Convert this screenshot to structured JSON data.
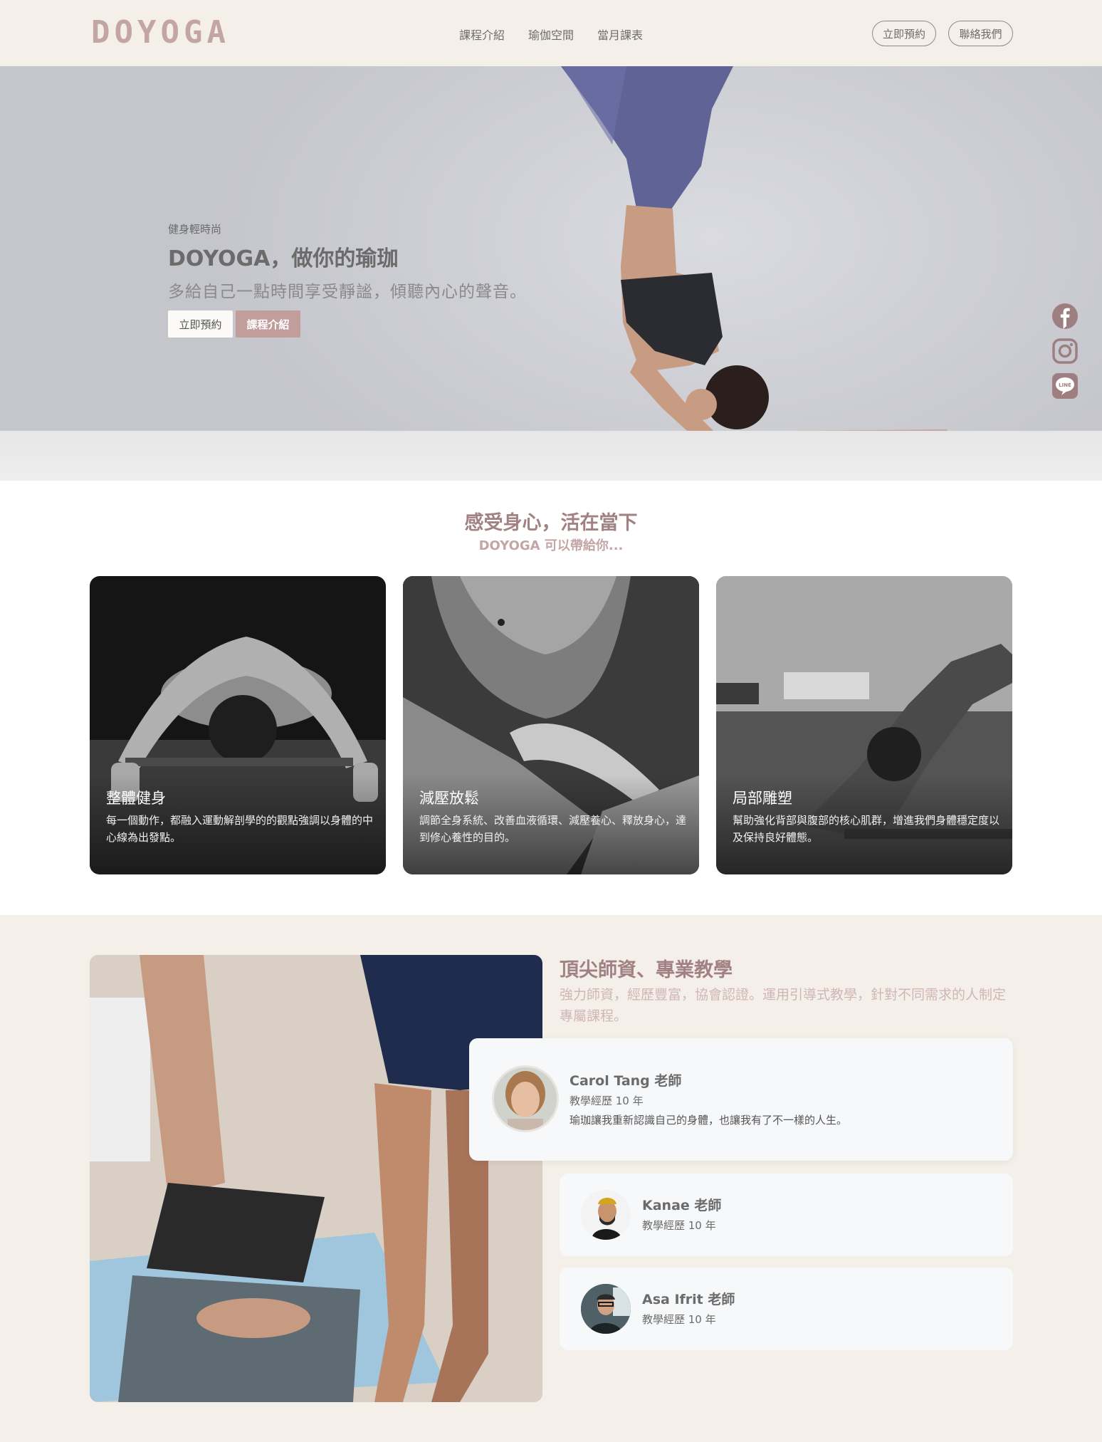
{
  "brand": {
    "logo": "DOYOGA",
    "accent": "#c3a5a6",
    "accent_dark": "#a18183",
    "beige": "#f4efe8"
  },
  "nav": {
    "items": [
      "課程介紹",
      "瑜伽空間",
      "當月課表"
    ]
  },
  "header_buttons": {
    "book": "立即預約",
    "contact": "聯絡我們"
  },
  "hero": {
    "kicker": "健身輕時尚",
    "title": "DOYOGA，做你的瑜珈",
    "subtitle": "多給自己一點時間享受靜謐，傾聽內心的聲音。",
    "btn_book": "立即預約",
    "btn_courses": "課程介紹"
  },
  "social": {
    "icons": [
      "facebook-icon",
      "instagram-icon",
      "line-icon"
    ],
    "line_text": "LINE"
  },
  "feel": {
    "title": "感受身心，活在當下",
    "subtitle": "DOYOGA 可以帶給你...",
    "cards": [
      {
        "title": "整體健身",
        "desc": "每一個動作，都融入運動解剖學的的觀點強調以身體的中心線為出發點。"
      },
      {
        "title": "減壓放鬆",
        "desc": "調節全身系統、改善血液循環、減壓養心、釋放身心，達到修心養性的目的。"
      },
      {
        "title": "局部雕塑",
        "desc": "幫助強化背部與腹部的核心肌群，增進我們身體穩定度以及保持良好體態。"
      }
    ]
  },
  "teachers": {
    "title": "頂尖師資、專業教學",
    "desc": "強力師資，經歷豐富，協會認證。運用引導式教學，針對不同需求的人制定專屬課程。",
    "list": [
      {
        "name": "Carol Tang 老師",
        "exp": "教學經歷 10 年",
        "quote": "瑜珈讓我重新認識自己的身體，也讓我有了不一樣的人生。"
      },
      {
        "name": "Kanae 老師",
        "exp": "教學經歷 10 年"
      },
      {
        "name": "Asa Ifrit 老師",
        "exp": "教學經歷 10 年"
      }
    ]
  }
}
